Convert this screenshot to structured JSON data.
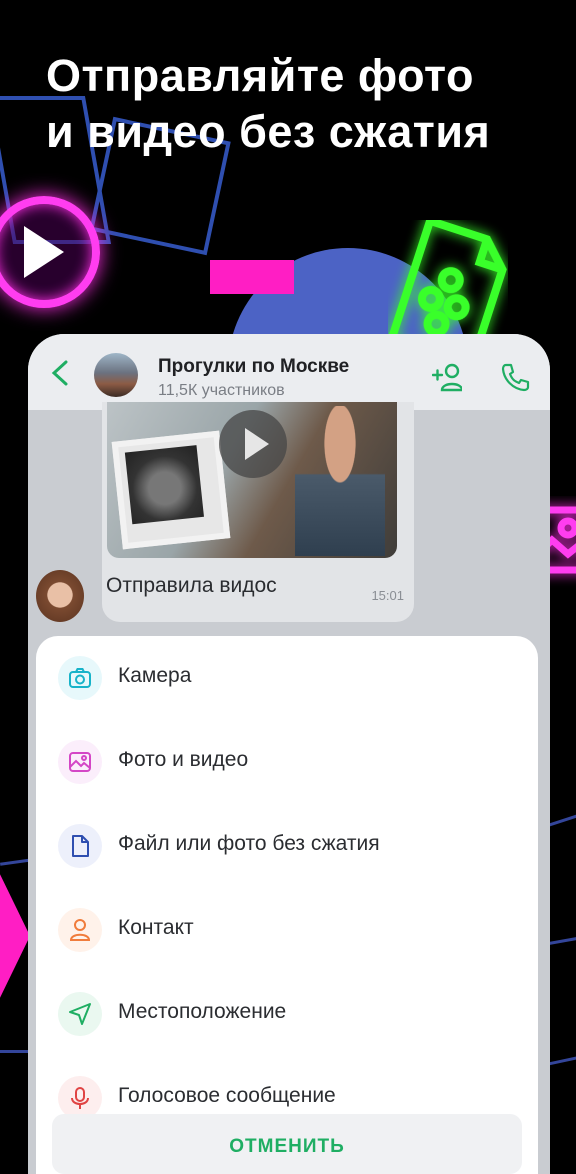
{
  "promo": {
    "headline_line1": "Отправляйте фото",
    "headline_line2": "и видео без сжатия"
  },
  "chat": {
    "title": "Прогулки по Москве",
    "subtitle": "11,5К участников",
    "message": {
      "text": "Отправила видос",
      "time": "15:01"
    }
  },
  "attach_menu": {
    "items": [
      {
        "label": "Камера",
        "icon": "camera-icon"
      },
      {
        "label": "Фото и видео",
        "icon": "image-icon"
      },
      {
        "label": "Файл или фото без сжатия",
        "icon": "file-icon"
      },
      {
        "label": "Контакт",
        "icon": "contact-icon"
      },
      {
        "label": "Местоположение",
        "icon": "location-icon"
      },
      {
        "label": "Голосовое сообщение",
        "icon": "microphone-icon"
      }
    ],
    "cancel_label": "ОТМЕНИТЬ"
  },
  "colors": {
    "accent_green": "#1fae63",
    "neon_pink": "#ff1ec4",
    "neon_green": "#39ff2a",
    "blue": "#4c63c5"
  }
}
